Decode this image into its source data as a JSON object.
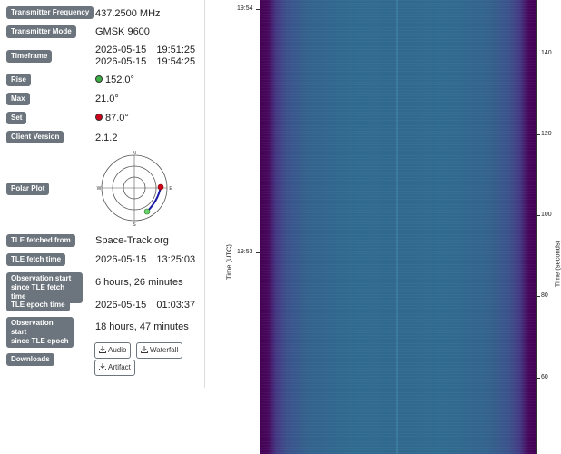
{
  "details": {
    "transmitter_frequency": {
      "label": "Transmitter Frequency",
      "value": "437.2500 MHz"
    },
    "transmitter_mode": {
      "label": "Transmitter Mode",
      "value": "GMSK 9600"
    },
    "timeframe": {
      "label": "Timeframe",
      "start_date": "2026-05-15",
      "start_time": "19:51:25",
      "end_date": "2026-05-15",
      "end_time": "19:54:25"
    },
    "rise": {
      "label": "Rise",
      "value": "152.0°",
      "dot_color": "#3cb043"
    },
    "max": {
      "label": "Max",
      "value": "21.0°"
    },
    "set": {
      "label": "Set",
      "value": "87.0°",
      "dot_color": "#d0021b"
    },
    "client_version": {
      "label": "Client Version",
      "value": "2.1.2"
    },
    "polar_plot": {
      "label": "Polar Plot",
      "n": "N",
      "e": "E",
      "s": "S",
      "w": "W"
    },
    "tle_fetched_from": {
      "label": "TLE fetched from",
      "value": "Space-Track.org"
    },
    "tle_fetch_time": {
      "label": "TLE fetch time",
      "date": "2026-05-15",
      "time": "13:25:03"
    },
    "obs_since_fetch": {
      "label_line1": "Observation start",
      "label_line2": "since TLE fetch time",
      "value": "6 hours, 26 minutes"
    },
    "tle_epoch_time": {
      "label": "TLE epoch time",
      "date": "2026-05-15",
      "time": "01:03:37"
    },
    "obs_since_epoch": {
      "label_line1": "Observation start",
      "label_line2": "since TLE epoch",
      "value": "18 hours, 47 minutes"
    },
    "downloads": {
      "label": "Downloads",
      "audio": "Audio",
      "waterfall": "Waterfall",
      "artifact": "Artifact"
    }
  },
  "waterfall": {
    "left_axis_title": "Time (UTC)",
    "right_axis_title": "Time (seconds)",
    "left_ticks": [
      "19:54",
      "19:53"
    ],
    "right_ticks": [
      "140",
      "120",
      "100",
      "80",
      "60"
    ],
    "colors": {
      "edge": "#440154",
      "mid": "#3b528b",
      "center": "#31688e"
    }
  }
}
